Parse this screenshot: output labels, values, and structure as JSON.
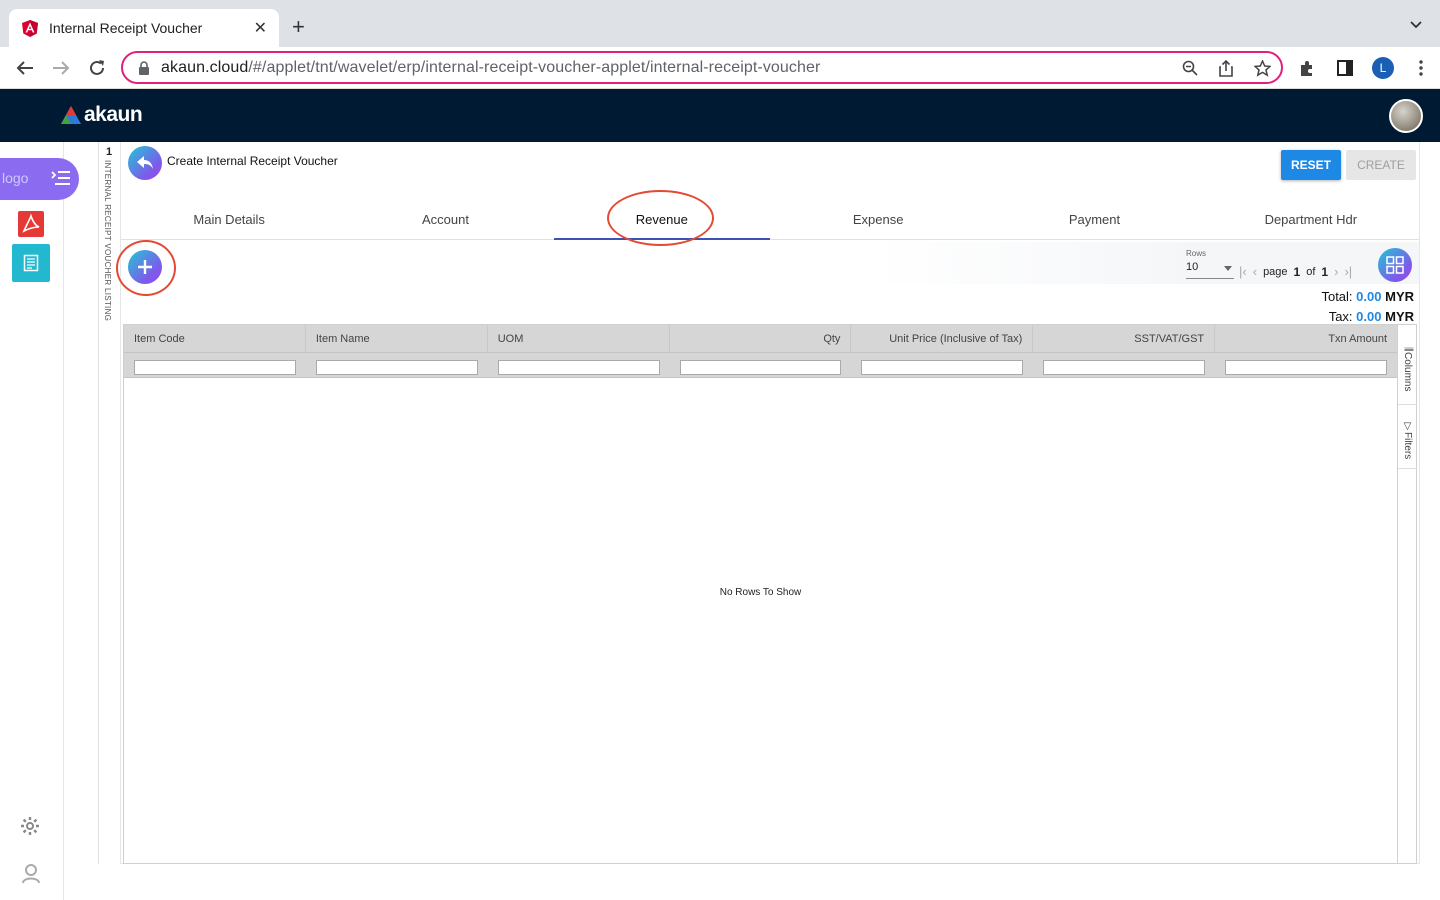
{
  "browser": {
    "tab_title": "Internal Receipt Voucher",
    "url_host": "akaun.cloud",
    "url_path": "/#/applet/tnt/wavelet/erp/internal-receipt-voucher-applet/internal-receipt-voucher",
    "profile_initial": "L"
  },
  "app": {
    "brand": "akaun",
    "logo_alt": "logo"
  },
  "listing_strip": {
    "count": "1",
    "label": "INTERNAL RECEIPT VOUCHER LISTING"
  },
  "page": {
    "title": "Create Internal Receipt Voucher",
    "reset_label": "RESET",
    "create_label": "CREATE"
  },
  "tabs": [
    {
      "label": "Main Details"
    },
    {
      "label": "Account"
    },
    {
      "label": "Revenue"
    },
    {
      "label": "Expense"
    },
    {
      "label": "Payment"
    },
    {
      "label": "Department Hdr"
    }
  ],
  "active_tab": "Revenue",
  "pager": {
    "rows_label": "Rows",
    "rows_value": "10",
    "page_word": "page",
    "current_page": "1",
    "of_word": "of",
    "total_pages": "1"
  },
  "totals": {
    "total_label": "Total:",
    "total_value": "0.00",
    "tax_label": "Tax:",
    "tax_value": "0.00",
    "currency": "MYR"
  },
  "grid": {
    "columns": [
      "Item Code",
      "Item Name",
      "UOM",
      "Qty",
      "Unit Price (Inclusive of Tax)",
      "SST/VAT/GST",
      "Txn Amount"
    ],
    "empty_message": "No Rows To Show",
    "side_tools": [
      "Columns",
      "Filters"
    ]
  },
  "colors": {
    "header_bg": "#001a33",
    "accent_blue": "#1e88e5",
    "annotation_red": "#e34a33",
    "rail_purple": "#8b6cf0"
  }
}
